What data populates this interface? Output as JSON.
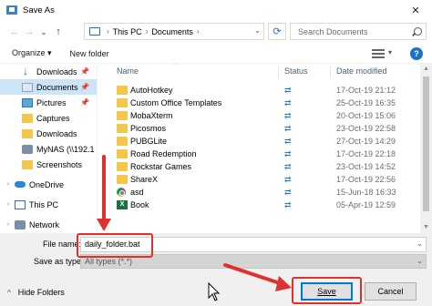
{
  "window": {
    "title": "Save As",
    "close_glyph": "✕"
  },
  "nav": {
    "back": "←",
    "forward": "→",
    "recent": "⌄",
    "up": "↑"
  },
  "address": {
    "segments": [
      "This PC",
      "Documents"
    ]
  },
  "search": {
    "placeholder": "Search Documents"
  },
  "toolbar": {
    "organize": "Organize ▾",
    "new_folder": "New folder",
    "help": "?"
  },
  "sidebar": {
    "items": [
      {
        "label": "Downloads",
        "icon": "download-arrow-icon",
        "pinned": true
      },
      {
        "label": "Documents",
        "icon": "documents-icon",
        "pinned": true,
        "selected": true
      },
      {
        "label": "Pictures",
        "icon": "pictures-icon",
        "pinned": true
      },
      {
        "label": "Captures",
        "icon": "folder-icon"
      },
      {
        "label": "Downloads",
        "icon": "folder-icon"
      },
      {
        "label": "MyNAS (\\\\192.1",
        "icon": "network-drive-icon"
      },
      {
        "label": "Screenshots",
        "icon": "folder-icon"
      },
      {
        "label": "OneDrive",
        "icon": "cloud-icon"
      },
      {
        "label": "This PC",
        "icon": "computer-icon"
      },
      {
        "label": "Network",
        "icon": "network-icon"
      }
    ]
  },
  "columns": {
    "name": "Name",
    "status": "Status",
    "date": "Date modified"
  },
  "files": [
    {
      "name": "AutoHotkey",
      "icon": "folder-icon",
      "status": "sync-icon",
      "date": "17-Oct-19 21:12"
    },
    {
      "name": "Custom Office Templates",
      "icon": "folder-icon",
      "status": "sync-icon",
      "date": "25-Oct-19 16:35"
    },
    {
      "name": "MobaXterm",
      "icon": "folder-icon",
      "status": "sync-icon",
      "date": "20-Oct-19 15:06"
    },
    {
      "name": "Picosmos",
      "icon": "folder-icon",
      "status": "sync-icon",
      "date": "23-Oct-19 22:58"
    },
    {
      "name": "PUBGLite",
      "icon": "folder-icon",
      "status": "sync-icon",
      "date": "27-Oct-19 14:29"
    },
    {
      "name": "Road Redemption",
      "icon": "folder-icon",
      "status": "sync-icon",
      "date": "17-Oct-19 22:18"
    },
    {
      "name": "Rockstar Games",
      "icon": "folder-icon",
      "status": "sync-icon",
      "date": "23-Oct-19 14:52"
    },
    {
      "name": "ShareX",
      "icon": "folder-icon",
      "status": "sync-icon",
      "date": "17-Oct-19 22:56"
    },
    {
      "name": "asd",
      "icon": "chrome-icon",
      "status": "sync-icon",
      "date": "15-Jun-18 16:33"
    },
    {
      "name": "Book",
      "icon": "excel-icon",
      "status": "sync-icon",
      "date": "05-Apr-19 12:59"
    }
  ],
  "file_name": {
    "label": "File name:",
    "value": "daily_folder.bat"
  },
  "save_as_type": {
    "label": "Save as type:",
    "value": "All types (*.*)"
  },
  "footer": {
    "hide_folders": "Hide Folders",
    "save": "Save",
    "cancel": "Cancel"
  },
  "colors": {
    "accent": "#0078d7",
    "annotation_red": "#e03030",
    "selected_bg": "#cce4f7",
    "folder_yellow": "#f4c64b"
  }
}
